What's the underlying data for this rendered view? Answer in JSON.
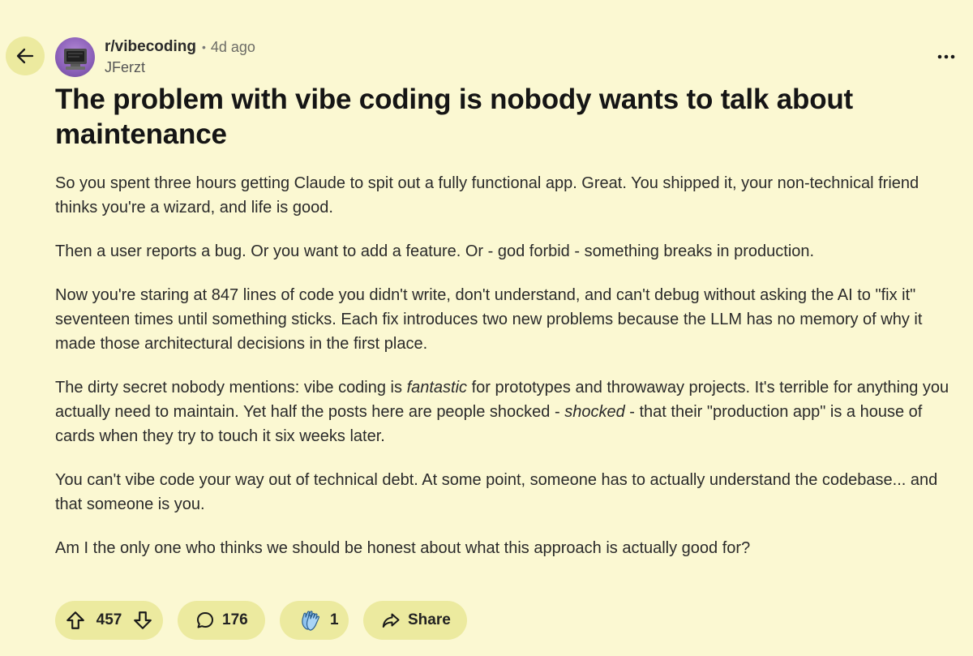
{
  "post": {
    "subreddit": "r/vibecoding",
    "separator": "•",
    "age": "4d ago",
    "author": "JFerzt",
    "title": "The problem with vibe coding is nobody wants to talk about maintenance",
    "paragraphs": [
      "So you spent three hours getting Claude to spit out a fully functional app. Great. You shipped it, your non-technical friend thinks you're a wizard, and life is good.",
      "Then a user reports a bug. Or you want to add a feature. Or - god forbid - something breaks in production.",
      "Now you're staring at 847 lines of code you didn't write, don't understand, and can't debug without asking the AI to \"fix it\" seventeen times until something sticks. Each fix introduces two new problems because the LLM has no memory of why it made those architectural decisions in the first place.",
      {
        "parts": [
          "The dirty secret nobody mentions: vibe coding is ",
          "fantastic",
          " for prototypes and throwaway projects. It's terrible for anything you actually need to maintain. Yet half the posts here are people shocked - ",
          "shocked",
          " - that their \"production app\" is a house of cards when they try to touch it six weeks later."
        ]
      },
      "You can't vibe code your way out of technical debt. At some point, someone has to actually understand the codebase... and that someone is you.",
      "Am I the only one who thinks we should be honest about what this approach is actually good for?"
    ]
  },
  "actions": {
    "vote_count": "457",
    "comment_count": "176",
    "award_count": "1",
    "share_label": "Share"
  },
  "icons": {
    "back": "arrow-left-icon",
    "more": "more-horizontal-icon",
    "upvote": "arrow-up-outline-icon",
    "downvote": "arrow-down-outline-icon",
    "comment": "speech-bubble-icon",
    "award": "clapping-hands-icon",
    "share": "share-arrow-icon"
  },
  "colors": {
    "background": "#fbf8d2",
    "pill": "#ecea9f",
    "text": "#1a1a1a"
  }
}
